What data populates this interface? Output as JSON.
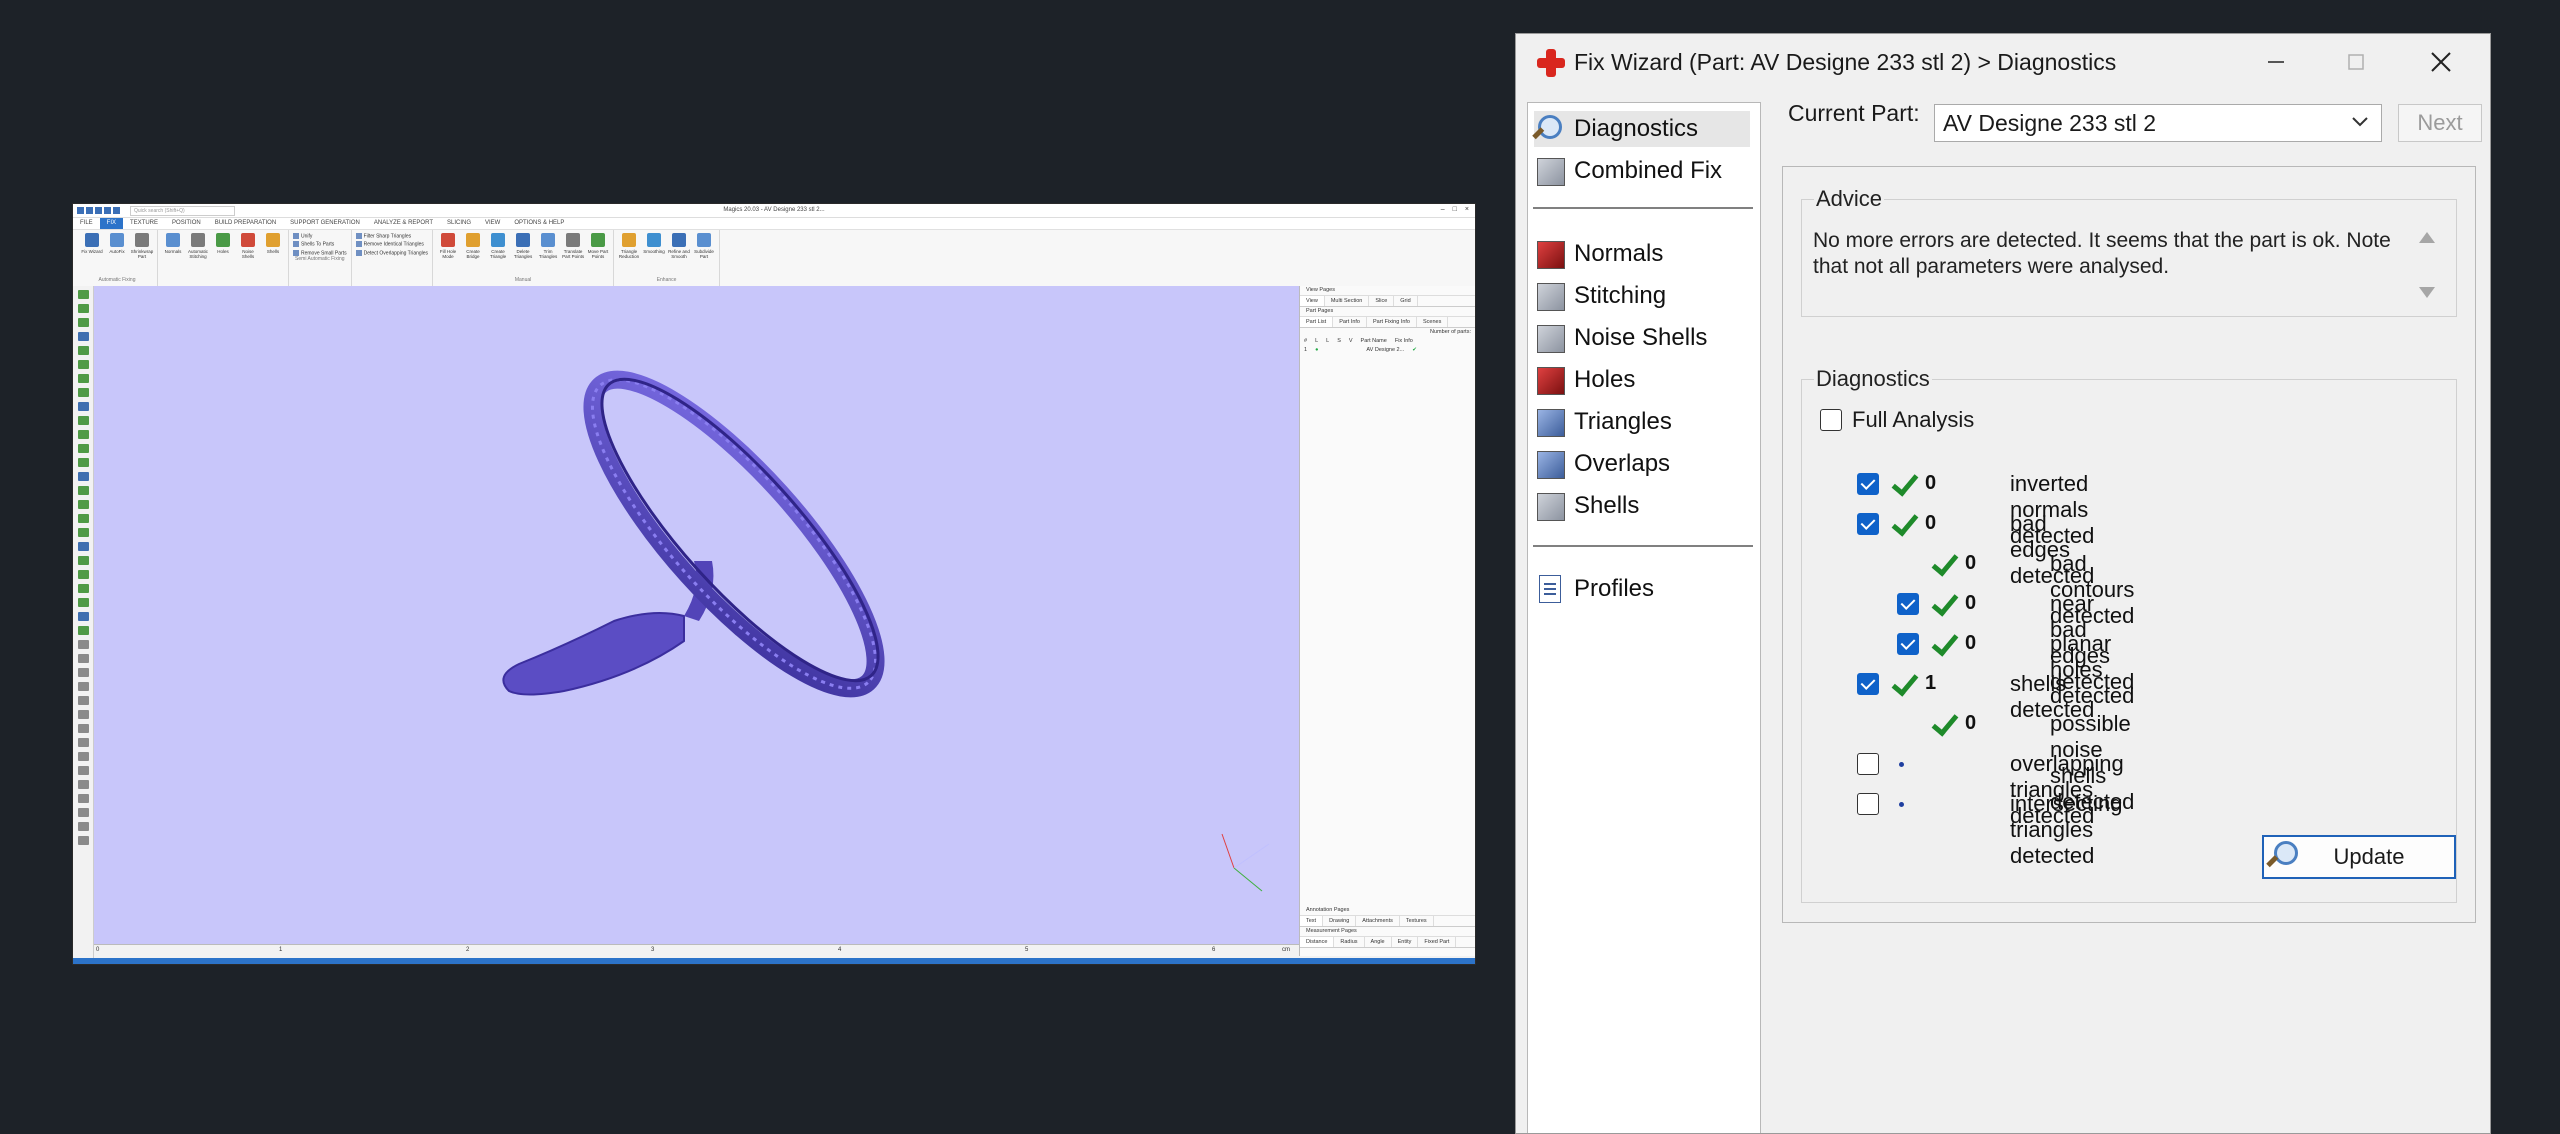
{
  "magics": {
    "window_title": "Magics 20.03 - AV Designe 233 stl 2...",
    "search_placeholder": "Quick search (Shift+Q)",
    "tabs": [
      "FILE",
      "FIX",
      "TEXTURE",
      "POSITION",
      "BUILD PREPARATION",
      "SUPPORT GENERATION",
      "ANALYZE & REPORT",
      "SLICING",
      "VIEW",
      "OPTIONS & HELP"
    ],
    "active_tab": "FIX",
    "ribbon_groups": [
      {
        "label": "Automatic Fixing",
        "buttons": [
          "Fix Wizard",
          "AutoFix",
          "Shrinkwrap Part"
        ]
      },
      {
        "label": "",
        "buttons": [
          "Normals",
          "Automatic Stitching",
          "Holes",
          "Noise Shells",
          "Shells"
        ]
      },
      {
        "label": "Semi Automatic Fixing",
        "list": [
          "Unify",
          "Shells To Parts",
          "Remove Small Parts"
        ]
      },
      {
        "label": "",
        "list": [
          "Filter Sharp Triangles",
          "Remove Identical Triangles",
          "Detect Overlapping Triangles"
        ]
      },
      {
        "label": "Manual",
        "buttons": [
          "Fill Hole Mode",
          "Create Bridge",
          "Create Triangle",
          "Delete Triangles",
          "Trim Triangles",
          "Translate Part Points",
          "Move Part Points"
        ]
      },
      {
        "label": "Enhance",
        "buttons": [
          "Triangle Reduction",
          "Smoothing",
          "Refine and Smooth",
          "Subdivide Part"
        ]
      }
    ],
    "ruler_ticks": [
      "0",
      "1",
      "2",
      "3",
      "4",
      "5",
      "6",
      "cm"
    ],
    "right_panel": {
      "view_pages": "View Pages",
      "view_tabs": [
        "View",
        "Multi Section",
        "Slice",
        "Grid"
      ],
      "part_pages": "Part Pages",
      "part_tabs": [
        "Part List",
        "Part Info",
        "Part Fixing Info",
        "Scenes"
      ],
      "number_of_parts": "Number of parts:",
      "list_header": [
        "#",
        "L",
        "L",
        "S",
        "V",
        "Part Name",
        "Fix Info"
      ],
      "list_row": {
        "index": "1",
        "name": "AV Designe 2..."
      },
      "annotation_pages": "Annotation Pages",
      "annotation_tabs": [
        "Text",
        "Drawing",
        "Attachments",
        "Textures"
      ],
      "measurement_pages": "Measurement Pages",
      "measurement_tabs": [
        "Distance",
        "Radius",
        "Angle",
        "Entity",
        "Fixed Part"
      ]
    },
    "colors": {
      "viewport": "#c8c6fa",
      "ring": "#5a4ec8",
      "accent": "#2c73c9"
    }
  },
  "fix_wizard": {
    "title": "Fix Wizard (Part: AV Designe 233 stl 2) > Diagnostics",
    "nav": {
      "top": [
        {
          "label": "Diagnostics",
          "icon": "magnifier-icon",
          "selected": true
        },
        {
          "label": "Combined Fix",
          "icon": "cube-stack-icon"
        }
      ],
      "middle": [
        {
          "label": "Normals",
          "icon": "normals-cube-icon"
        },
        {
          "label": "Stitching",
          "icon": "stitching-cube-icon"
        },
        {
          "label": "Noise Shells",
          "icon": "noise-shells-icon"
        },
        {
          "label": "Holes",
          "icon": "holes-cube-icon"
        },
        {
          "label": "Triangles",
          "icon": "triangles-icon"
        },
        {
          "label": "Overlaps",
          "icon": "overlaps-icon"
        },
        {
          "label": "Shells",
          "icon": "shells-icon"
        }
      ],
      "bottom": [
        {
          "label": "Profiles",
          "icon": "profiles-doc-icon"
        }
      ]
    },
    "current_part_label": "Current Part:",
    "current_part_value": "AV Designe 233 stl 2",
    "next_label": "Next",
    "advice_title": "Advice",
    "advice_text": "No more errors are detected. It seems that the part is ok. Note that not all parameters were analysed.",
    "diagnostics_title": "Diagnostics",
    "full_analysis_label": "Full Analysis",
    "full_analysis_checked": false,
    "rows": [
      {
        "checked": true,
        "status": "ok",
        "count": "0",
        "label": "inverted normals detected",
        "indent": 0
      },
      {
        "checked": true,
        "status": "ok",
        "count": "0",
        "label": "bad edges detected",
        "indent": 0
      },
      {
        "checked": null,
        "status": "ok",
        "count": "0",
        "label": "bad contours detected",
        "indent": 1
      },
      {
        "checked": true,
        "status": "ok",
        "count": "0",
        "label": "near bad edges detected",
        "indent": 1
      },
      {
        "checked": true,
        "status": "ok",
        "count": "0",
        "label": "planar holes detected",
        "indent": 1
      },
      {
        "checked": true,
        "status": "ok",
        "count": "1",
        "label": "shells detected",
        "indent": 0
      },
      {
        "checked": null,
        "status": "ok",
        "count": "0",
        "label": "possible noise shells detected",
        "indent": 1
      },
      {
        "checked": false,
        "status": "none",
        "count": "",
        "label": "overlapping triangles detected",
        "indent": 0
      },
      {
        "checked": false,
        "status": "none",
        "count": "",
        "label": "intersecting triangles detected",
        "indent": 0
      }
    ],
    "update_label": "Update"
  }
}
